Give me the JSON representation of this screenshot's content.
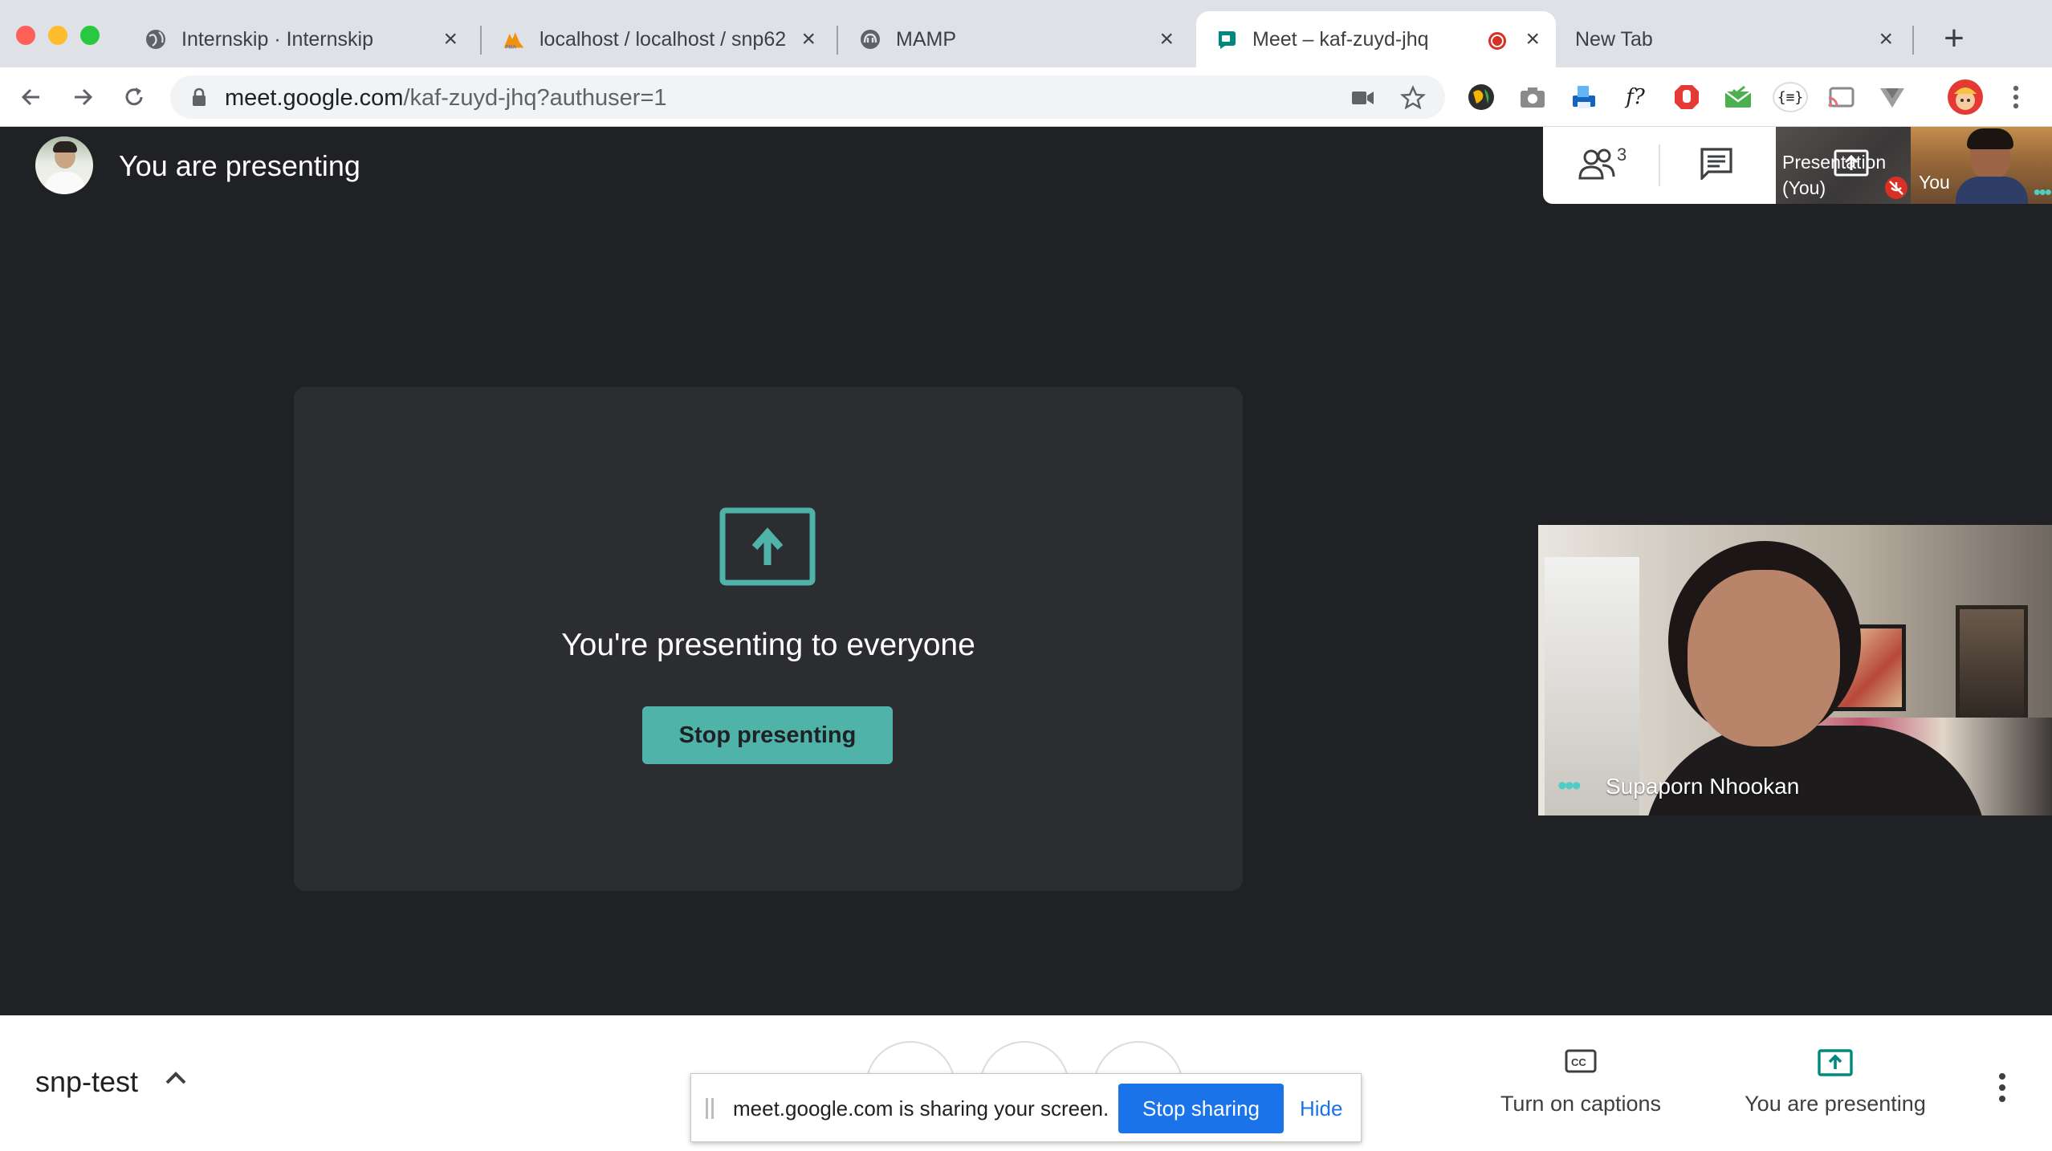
{
  "browser": {
    "tabs": [
      {
        "title": "Internskip · Internskip",
        "favicon": "globe-icon"
      },
      {
        "title": "localhost / localhost / snp62",
        "favicon": "phpmyadmin-icon"
      },
      {
        "title": "MAMP",
        "favicon": "mamp-icon"
      },
      {
        "title": "Meet – kaf-zuyd-jhq",
        "favicon": "meet-icon",
        "active": true,
        "recording": true
      },
      {
        "title": "New Tab",
        "favicon": ""
      }
    ],
    "url_host": "meet.google.com",
    "url_path": "/kaf-zuyd-jhq?authuser=1",
    "extensions": [
      "globe-ext-icon",
      "camera-ext-icon",
      "printer-ext-icon",
      "fx-ext-icon",
      "adblock-ext-icon",
      "mail-ext-icon",
      "json-ext-icon",
      "cast-ext-icon",
      "vue-ext-icon",
      "profile-avatar-icon"
    ],
    "fx_label": "f?",
    "json_label": "{≡}"
  },
  "meet": {
    "header": {
      "presenting_label": "You are presenting"
    },
    "panel": {
      "people_count": "3",
      "thumb_presentation_label": "Presentation (You)",
      "thumb_you_label": "You"
    },
    "card": {
      "message": "You're presenting to everyone",
      "stop_button": "Stop presenting"
    },
    "participant": {
      "name": "Supaporn Nhookan"
    },
    "bottom": {
      "meeting_name": "snp-test",
      "captions_label": "Turn on captions",
      "presenting_label": "You are presenting"
    },
    "share_bar": {
      "text": "meet.google.com is sharing your screen.",
      "stop_label": "Stop sharing",
      "hide_label": "Hide"
    }
  },
  "colors": {
    "accent_teal": "#4fb3a9",
    "chrome_blue": "#1a73e8",
    "meet_bg": "#202124",
    "record_red": "#d93025"
  }
}
